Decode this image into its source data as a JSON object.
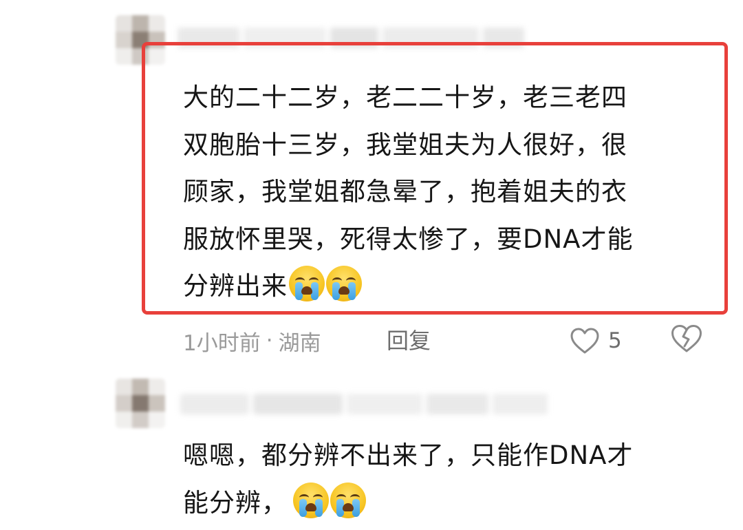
{
  "comments": [
    {
      "text_lines": [
        "大的二十二岁，老二二十岁，老三老四",
        "双胞胎十三岁，我堂姐夫为人很好，很",
        "顾家，我堂姐都急晕了，抱着姐夫的衣",
        "服放怀里哭，死得太惨了，要DNA才能",
        "分辨出来"
      ],
      "emoji": [
        "loudly-crying-face",
        "loudly-crying-face"
      ],
      "time": "1小时前",
      "separator": "·",
      "location": "湖南",
      "reply_label": "回复",
      "like_count": "5",
      "highlighted": true,
      "highlight_color": "#e8403b"
    },
    {
      "text_lines": [
        "嗯嗯，都分辨不出来了，只能作DNA才",
        "能分辨，"
      ],
      "emoji": [
        "loudly-crying-face",
        "loudly-crying-face"
      ]
    }
  ],
  "colors": {
    "meta_text": "#9a9a9a",
    "action_text": "#6d6d6d",
    "body_text": "#161616"
  }
}
